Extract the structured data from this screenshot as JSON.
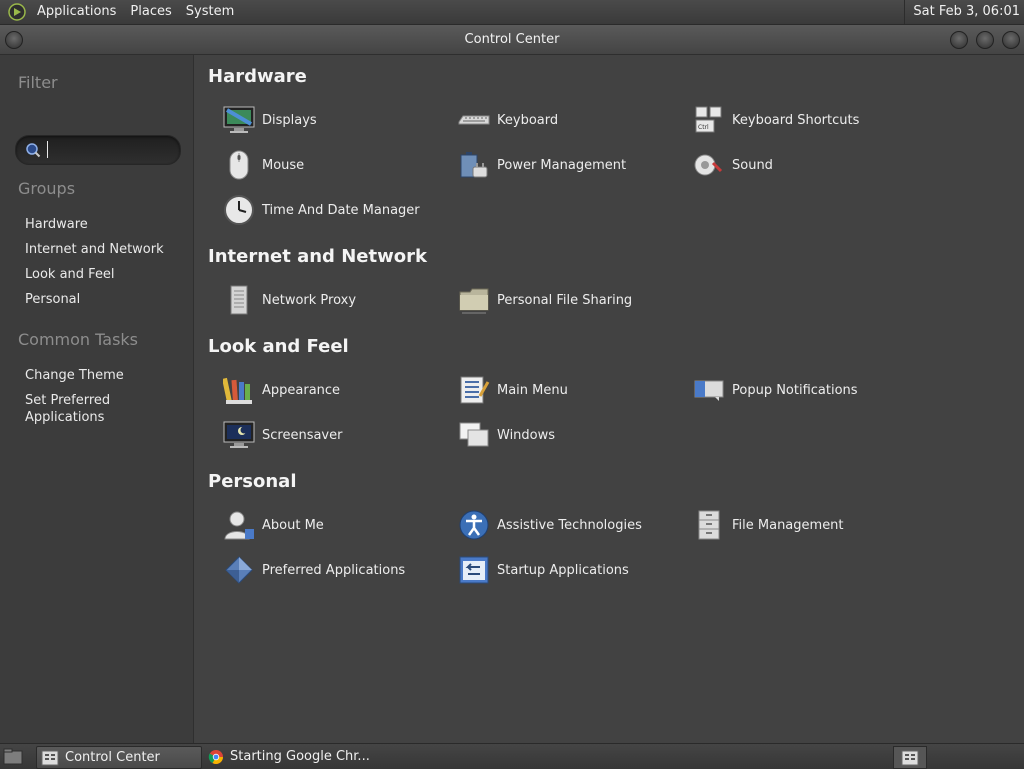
{
  "top_panel": {
    "menus": [
      "Applications",
      "Places",
      "System"
    ],
    "clock": "Sat Feb  3, 06:01"
  },
  "window": {
    "title": "Control Center"
  },
  "sidebar": {
    "filter_heading": "Filter",
    "search": {
      "value": "",
      "placeholder": ""
    },
    "groups_heading": "Groups",
    "groups": [
      "Hardware",
      "Internet and Network",
      "Look and Feel",
      "Personal"
    ],
    "tasks_heading": "Common Tasks",
    "tasks": [
      "Change Theme",
      "Set Preferred Applications"
    ]
  },
  "main": {
    "groups": [
      {
        "title": "Hardware",
        "items": [
          {
            "label": "Displays",
            "icon": "display-icon"
          },
          {
            "label": "Keyboard",
            "icon": "keyboard-icon"
          },
          {
            "label": "Keyboard Shortcuts",
            "icon": "keyboard-shortcuts-icon"
          },
          {
            "label": "Mouse",
            "icon": "mouse-icon"
          },
          {
            "label": "Power Management",
            "icon": "power-management-icon"
          },
          {
            "label": "Sound",
            "icon": "sound-icon"
          },
          {
            "label": "Time And Date Manager",
            "icon": "clock-icon"
          }
        ]
      },
      {
        "title": "Internet and Network",
        "items": [
          {
            "label": "Network Proxy",
            "icon": "network-proxy-icon"
          },
          {
            "label": "Personal File Sharing",
            "icon": "folder-share-icon"
          }
        ]
      },
      {
        "title": "Look and Feel",
        "items": [
          {
            "label": "Appearance",
            "icon": "appearance-icon"
          },
          {
            "label": "Main Menu",
            "icon": "main-menu-icon"
          },
          {
            "label": "Popup Notifications",
            "icon": "popup-notification-icon"
          },
          {
            "label": "Screensaver",
            "icon": "screensaver-icon"
          },
          {
            "label": "Windows",
            "icon": "windows-icon"
          }
        ]
      },
      {
        "title": "Personal",
        "items": [
          {
            "label": "About Me",
            "icon": "user-icon"
          },
          {
            "label": "Assistive Technologies",
            "icon": "accessibility-icon"
          },
          {
            "label": "File Management",
            "icon": "file-cabinet-icon"
          },
          {
            "label": "Preferred Applications",
            "icon": "preferred-apps-icon"
          },
          {
            "label": "Startup Applications",
            "icon": "startup-apps-icon"
          }
        ]
      }
    ]
  },
  "bottom_panel": {
    "tasks": [
      {
        "label": "Control Center",
        "icon": "control-center-icon"
      },
      {
        "label": "Starting Google Chr...",
        "icon": "chrome-icon"
      }
    ]
  },
  "colors": {
    "accent": "#3b6fb6",
    "panel": "#3a3a3a",
    "window_bg": "#424242"
  }
}
